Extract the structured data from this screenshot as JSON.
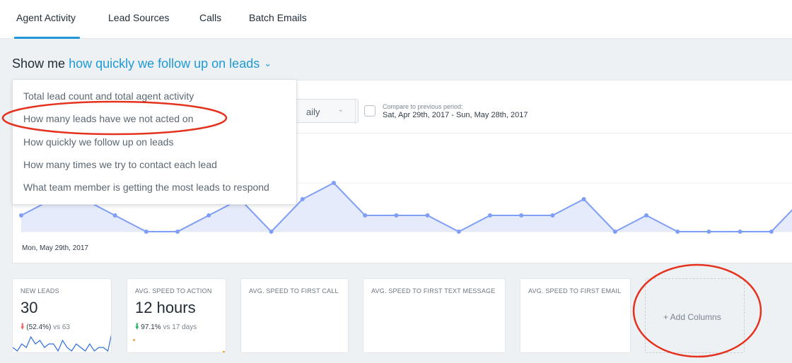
{
  "nav": {
    "tabs": [
      {
        "label": "Agent Activity",
        "active": true
      },
      {
        "label": "Lead Sources",
        "active": false
      },
      {
        "label": "Calls",
        "active": false
      },
      {
        "label": "Batch Emails",
        "active": false
      }
    ]
  },
  "showme": {
    "prefix": "Show me",
    "selected": "how quickly we follow up on leads"
  },
  "menu": {
    "items": [
      "Total lead count and total agent activity",
      "How many leads have we not acted on",
      "How quickly we follow up on leads",
      "How many times we try to contact each lead",
      "What team member is getting the most leads to respond"
    ]
  },
  "toolbar": {
    "granularity": "aily",
    "compare_label": "Compare to previous period:",
    "compare_range": "Sat, Apr 29th, 2017 - Sun, May 28th, 2017",
    "compare_checked": false
  },
  "chart_data": {
    "type": "area",
    "x_start_label": "Mon, May 29th, 2017",
    "values": [
      1,
      2,
      2,
      1,
      0,
      0,
      1,
      2,
      0,
      2,
      3,
      1,
      1,
      1,
      0,
      1,
      1,
      1,
      2,
      0,
      1,
      0,
      0,
      0,
      0,
      2,
      1
    ],
    "ylim": [
      0,
      3
    ],
    "line_color": "#7f9ef5",
    "fill_color": "#e6ebfb"
  },
  "cards": [
    {
      "title": "NEW LEADS",
      "value": "30",
      "delta": "(52.4%)",
      "vs": "vs 63",
      "trend": "down-red"
    },
    {
      "title": "AVG. SPEED TO ACTION",
      "value": "12 hours",
      "delta": "97.1%",
      "vs": "vs 17 days",
      "trend": "down-green"
    },
    {
      "title": "AVG. SPEED TO FIRST CALL"
    },
    {
      "title": "AVG. SPEED TO FIRST TEXT MESSAGE"
    },
    {
      "title": "AVG. SPEED TO FIRST EMAIL"
    }
  ],
  "add_columns_label": "+ Add Columns",
  "sparkline": [
    1,
    0,
    2,
    1,
    4,
    2,
    3,
    1,
    2,
    2,
    0,
    3,
    1,
    0,
    2,
    1,
    0,
    2,
    0,
    1,
    1,
    0,
    6
  ],
  "colors": {
    "accent": "#1f9ad6",
    "annotation": "#e5321e"
  }
}
